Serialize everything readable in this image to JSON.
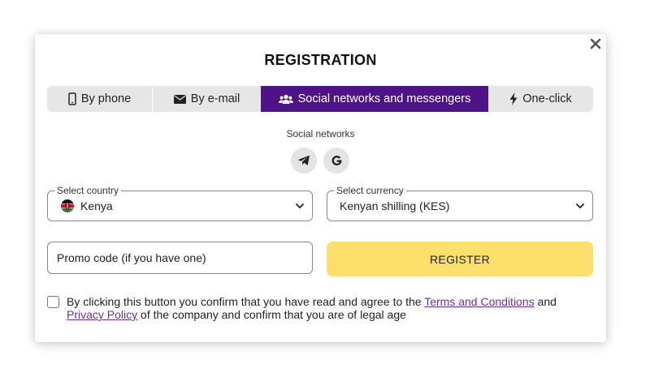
{
  "modal": {
    "title": "REGISTRATION",
    "close_icon": "close-icon"
  },
  "tabs": [
    {
      "label": "By phone",
      "icon": "phone-icon",
      "active": false
    },
    {
      "label": "By e-mail",
      "icon": "envelope-icon",
      "active": false
    },
    {
      "label": "Social networks and messengers",
      "icon": "users-icon",
      "active": true
    },
    {
      "label": "One-click",
      "icon": "lightning-icon",
      "active": false
    }
  ],
  "social": {
    "label": "Social networks",
    "buttons": [
      {
        "name": "telegram",
        "icon": "telegram-icon"
      },
      {
        "name": "google",
        "icon": "google-icon"
      }
    ]
  },
  "country": {
    "label": "Select country",
    "value": "Kenya",
    "flag_icon": "kenya-flag-icon"
  },
  "currency": {
    "label": "Select currency",
    "value": "Kenyan shilling (KES)"
  },
  "promo": {
    "placeholder": "Promo code (if you have one)"
  },
  "register_button": {
    "label": "REGISTER"
  },
  "agreement": {
    "checked": false,
    "text_before": "By clicking this button you confirm that you have read and agree to the",
    "terms_link": "Terms and Conditions",
    "text_and": "and",
    "privacy_link": "Privacy Policy",
    "text_after": "of the company and confirm that you are of legal age"
  },
  "colors": {
    "active_tab": "#4e1485",
    "tab_background": "#e6e6e6",
    "register_button": "#fde06b",
    "link": "#6b2fa0"
  }
}
